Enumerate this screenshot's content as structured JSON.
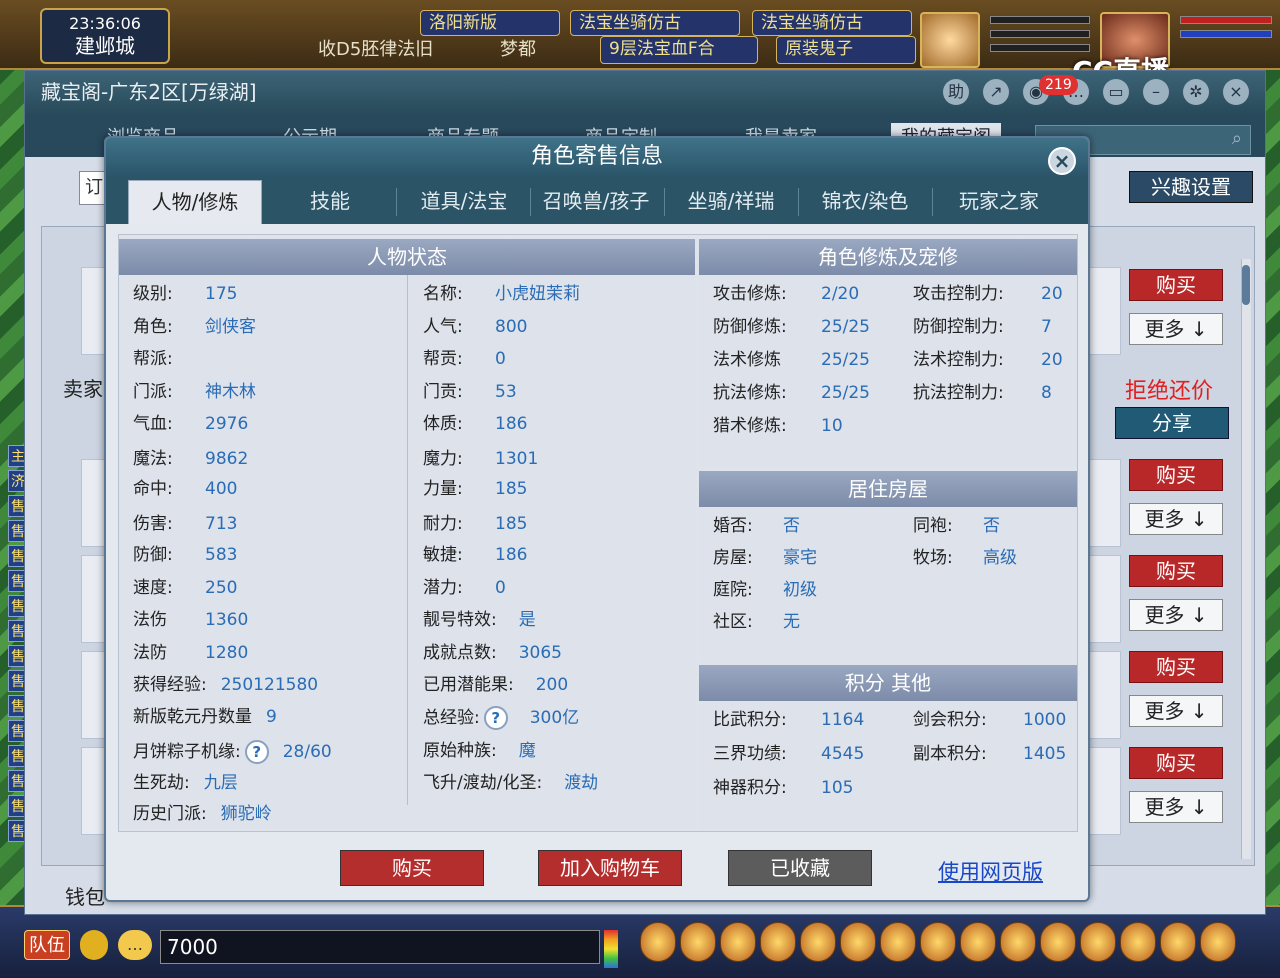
{
  "game": {
    "clock": "23:36:06",
    "city": "建邺城",
    "banners_top": [
      "洛阳新版",
      "法宝坐骑仿古",
      "法宝坐骑仿古"
    ],
    "banners_bottom": [
      "收D5胚律法旧",
      "梦都",
      "9层法宝血F合",
      "原装鬼子"
    ],
    "cc_logo": "CC直播",
    "coin_value": "7000",
    "team_label": "队伍",
    "chat_icon": "…",
    "left_strip": [
      "主",
      "济",
      "售",
      "售",
      "售",
      "售",
      "售",
      "售",
      "售",
      "售",
      "售",
      "售",
      "售",
      "售",
      "售",
      "售"
    ]
  },
  "window": {
    "title": "藏宝阁-广东2区[万绿湖]",
    "notification_count": "219",
    "help_icon": "助",
    "nav_items": [
      "浏览商品",
      "公示期",
      "商品专题",
      "商品定制",
      "我是卖家",
      "我的藏宝阁"
    ],
    "interest_button": "兴趣设置",
    "tiny_box": "订",
    "seller_label": "卖家",
    "wallet_label": "钱包",
    "refuse_bargain": "拒绝还价",
    "share_button": "分享",
    "buy_label": "购买",
    "more_label": "更多 ↓"
  },
  "modal": {
    "title": "角色寄售信息",
    "close_icon": "×",
    "tabs": [
      "人物/修炼",
      "技能",
      "道具/法宝",
      "召唤兽/孩子",
      "坐骑/祥瑞",
      "锦衣/染色",
      "玩家之家"
    ],
    "active_tab": 0,
    "status_title": "人物状态",
    "status_left": [
      {
        "k": "级别:",
        "v": "175"
      },
      {
        "k": "角色:",
        "v": "剑侠客"
      },
      {
        "k": "帮派:",
        "v": ""
      },
      {
        "k": "门派:",
        "v": "神木林"
      },
      {
        "k": "气血:",
        "v": "2976"
      },
      {
        "k": "魔法:",
        "v": "9862"
      },
      {
        "k": "命中:",
        "v": "400"
      },
      {
        "k": "伤害:",
        "v": "713"
      },
      {
        "k": "防御:",
        "v": "583"
      },
      {
        "k": "速度:",
        "v": "250"
      },
      {
        "k": "法伤",
        "v": "1360"
      },
      {
        "k": "法防",
        "v": "1280"
      },
      {
        "k": "获得经验:",
        "v": "250121580"
      },
      {
        "k": "新版乾元丹数量",
        "v": "9"
      },
      {
        "k": "月饼粽子机缘:",
        "v": "28/60",
        "q": true
      },
      {
        "k": "生死劫:",
        "v": "九层"
      },
      {
        "k": "历史门派:",
        "v": "狮驼岭"
      }
    ],
    "status_right": [
      {
        "k": "名称:",
        "v": "小虎妞茉莉"
      },
      {
        "k": "人气:",
        "v": "800"
      },
      {
        "k": "帮贡:",
        "v": "0"
      },
      {
        "k": "门贡:",
        "v": "53"
      },
      {
        "k": "体质:",
        "v": "186"
      },
      {
        "k": "魔力:",
        "v": "1301"
      },
      {
        "k": "力量:",
        "v": "185"
      },
      {
        "k": "耐力:",
        "v": "185"
      },
      {
        "k": "敏捷:",
        "v": "186"
      },
      {
        "k": "潜力:",
        "v": "0"
      },
      {
        "k": "靓号特效:",
        "v": "是"
      },
      {
        "k": "成就点数:",
        "v": "3065"
      },
      {
        "k": "已用潜能果:",
        "v": "200"
      },
      {
        "k": "总经验:",
        "v": "300亿",
        "q": true
      },
      {
        "k": "原始种族:",
        "v": "魔"
      },
      {
        "k": "飞升/渡劫/化圣:",
        "v": "渡劫"
      }
    ],
    "cultivation_title": "角色修炼及宠修",
    "cultivation": [
      {
        "k": "攻击修炼:",
        "v": "2/20",
        "k2": "攻击控制力:",
        "v2": "20"
      },
      {
        "k": "防御修炼:",
        "v": "25/25",
        "k2": "防御控制力:",
        "v2": "7"
      },
      {
        "k": "法术修炼",
        "v": "25/25",
        "k2": "法术控制力:",
        "v2": "20"
      },
      {
        "k": "抗法修炼:",
        "v": "25/25",
        "k2": "抗法控制力:",
        "v2": "8"
      },
      {
        "k": "猎术修炼:",
        "v": "10",
        "k2": "",
        "v2": ""
      }
    ],
    "housing_title": "居住房屋",
    "housing": [
      {
        "k": "婚否:",
        "v": "否",
        "k2": "同袍:",
        "v2": "否"
      },
      {
        "k": "房屋:",
        "v": "豪宅",
        "k2": "牧场:",
        "v2": "高级"
      },
      {
        "k": "庭院:",
        "v": "初级",
        "k2": "",
        "v2": ""
      },
      {
        "k": "社区:",
        "v": "无",
        "k2": "",
        "v2": ""
      }
    ],
    "points_title": "积分 其他",
    "points": [
      {
        "k": "比武积分:",
        "v": "1164",
        "k2": "剑会积分:",
        "v2": "1000"
      },
      {
        "k": "三界功绩:",
        "v": "4545",
        "k2": "副本积分:",
        "v2": "1405"
      },
      {
        "k": "神器积分:",
        "v": "105",
        "k2": "",
        "v2": ""
      }
    ],
    "buttons": {
      "buy": "购买",
      "add_cart": "加入购物车",
      "collected": "已收藏",
      "web_version": "使用网页版"
    }
  },
  "colors": {
    "accent_blue": "#2a6cb5",
    "buy_red": "#b52e2e",
    "header_teal": "#2b5467"
  }
}
